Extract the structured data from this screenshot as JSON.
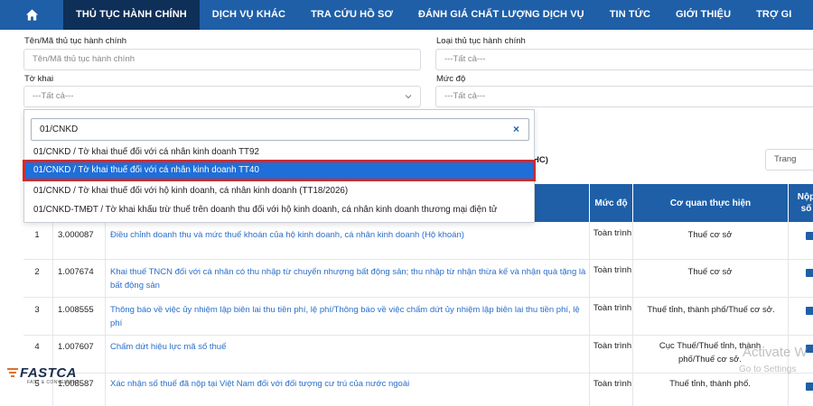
{
  "nav": {
    "home_icon": "home-icon",
    "items": [
      {
        "label": "THỦ TỤC HÀNH CHÍNH",
        "active": true
      },
      {
        "label": "DỊCH VỤ KHÁC",
        "active": false
      },
      {
        "label": "TRA CỨU HỒ SƠ",
        "active": false
      },
      {
        "label": "ĐÁNH GIÁ CHẤT LƯỢNG DỊCH VỤ",
        "active": false
      },
      {
        "label": "TIN TỨC",
        "active": false
      },
      {
        "label": "GIỚI THIỆU",
        "active": false
      },
      {
        "label": "TRỢ GI",
        "active": false
      }
    ]
  },
  "filters": {
    "name_label": "Tên/Mã thủ tục hành chính",
    "name_placeholder": "Tên/Mã thủ tục hành chính",
    "type_label": "Loại thủ tục hành chính",
    "type_value": "---Tất cả---",
    "form_label": "Tờ khai",
    "form_value": "---Tất cả---",
    "level_label": "Mức độ",
    "level_value": "---Tất cả---"
  },
  "dropdown": {
    "search_value": "01/CNKD",
    "clear_icon": "close-icon",
    "options": [
      {
        "label": "01/CNKD / Tờ khai thuế đối với cá nhân kinh doanh TT92",
        "selected": false
      },
      {
        "label": "01/CNKD / Tờ khai thuế đối với cá nhân kinh doanh TT40",
        "selected": true
      },
      {
        "label": "01/CNKD / Tờ khai thuế đối với hộ kinh doanh, cá nhân kinh doanh (TT18/2026)",
        "selected": false
      },
      {
        "label": "01/CNKD-TMĐT / Tờ khai khấu trừ thuế trên doanh thu đối với hộ kinh doanh, cá nhân kinh doanh thương mại điện tử",
        "selected": false
      }
    ]
  },
  "partial_label": "HC)",
  "pager": {
    "label": "Trang"
  },
  "table": {
    "headers": {
      "level": "Mức độ",
      "agency": "Cơ quan thực hiện",
      "submit": "Nộp\nsố"
    },
    "rows": [
      {
        "idx": "1",
        "code": "3.000087",
        "name": "Điều chỉnh doanh thu và mức thuế khoán của hộ kinh doanh, cá nhân kinh doanh (Hộ khoán)",
        "level": "Toàn trình",
        "agency": "Thuế cơ sở"
      },
      {
        "idx": "2",
        "code": "1.007674",
        "name": "Khai thuế TNCN đối với cá nhân có thu nhập từ chuyển nhượng bất động sản; thu nhập từ nhận thừa kế và nhận quà tặng là bất động sản",
        "level": "Toàn trình",
        "agency": "Thuế cơ sở"
      },
      {
        "idx": "3",
        "code": "1.008555",
        "name": "Thông báo về việc ủy nhiệm lập biên lai thu tiền phí, lệ phí/Thông báo về việc chấm dứt ủy nhiệm lập biên lai thu tiền phí, lệ phí",
        "level": "Toàn trình",
        "agency": "Thuế tỉnh, thành phố/Thuế cơ sở."
      },
      {
        "idx": "4",
        "code": "1.007607",
        "name": "Chấm dứt hiệu lực mã số thuế",
        "level": "Toàn trình",
        "agency": "Cục Thuế/Thuế tỉnh, thành phố/Thuế cơ sở."
      },
      {
        "idx": "5",
        "code": "1.008587",
        "name": "Xác nhận số thuế đã nộp tại Việt Nam đối với đối tượng cư trú của nước ngoài",
        "level": "Toàn trình",
        "agency": "Thuế tỉnh, thành phố."
      }
    ]
  },
  "watermark": {
    "line1": "Activate W",
    "line2": "Go to Settings"
  },
  "logo": {
    "name": "FASTCA",
    "sub": "FAST & CONVENIENT"
  },
  "colors": {
    "nav_bg": "#1e5fa8",
    "nav_active": "#0e2f58",
    "link": "#2a6ec9",
    "selected_option": "#1e6fd9",
    "highlight_border": "#d42a2a"
  }
}
